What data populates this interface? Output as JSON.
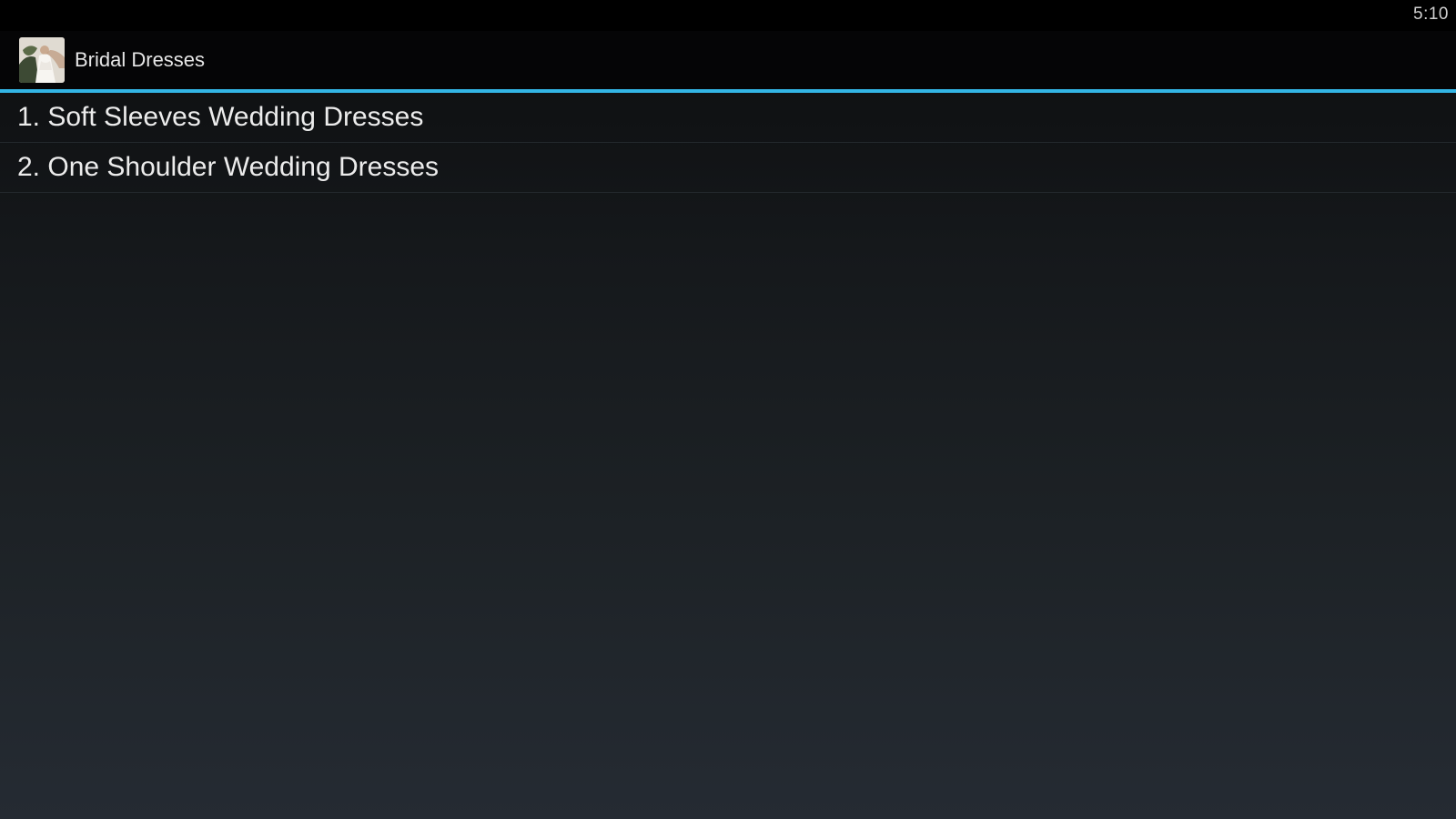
{
  "status_bar": {
    "time": "5:10"
  },
  "action_bar": {
    "title": "Bridal Dresses",
    "icon": "bridal-app-icon"
  },
  "list": {
    "items": [
      {
        "label": "1. Soft Sleeves Wedding Dresses"
      },
      {
        "label": "2. One Shoulder Wedding Dresses"
      }
    ]
  },
  "colors": {
    "accent": "#33b5e5",
    "status_bar_bg": "#000000",
    "action_bar_bg": "#050506",
    "text": "#ececec"
  }
}
